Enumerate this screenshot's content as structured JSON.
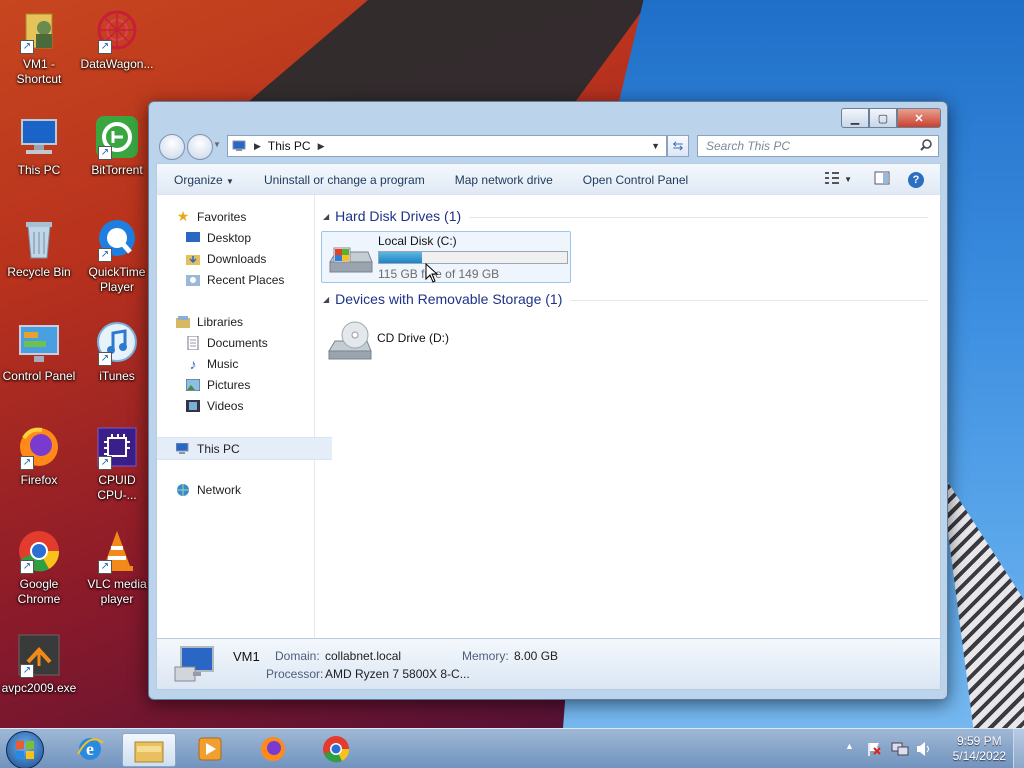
{
  "desktop": {
    "icons": [
      {
        "label": "VM1 - Shortcut",
        "icon": "user-folder-icon"
      },
      {
        "label": "DataWagon...",
        "icon": "datawagon-icon"
      },
      {
        "label": "This PC",
        "icon": "computer-icon"
      },
      {
        "label": "BitTorrent",
        "icon": "bittorrent-icon"
      },
      {
        "label": "Recycle Bin",
        "icon": "recycle-bin-icon"
      },
      {
        "label": "QuickTime Player",
        "icon": "quicktime-icon"
      },
      {
        "label": "Control Panel",
        "icon": "control-panel-icon"
      },
      {
        "label": "iTunes",
        "icon": "itunes-icon"
      },
      {
        "label": "Firefox",
        "icon": "firefox-icon"
      },
      {
        "label": "CPUID CPU-...",
        "icon": "cpuid-icon"
      },
      {
        "label": "Google Chrome",
        "icon": "chrome-icon"
      },
      {
        "label": "VLC media player",
        "icon": "vlc-icon"
      },
      {
        "label": "avpc2009.exe",
        "icon": "avpc-icon"
      }
    ]
  },
  "window": {
    "address": {
      "location": "This PC"
    },
    "search": {
      "placeholder": "Search This PC"
    },
    "toolbar": {
      "organize": "Organize",
      "uninstall": "Uninstall or change a program",
      "map_drive": "Map network drive",
      "control_panel": "Open Control Panel"
    },
    "nav": {
      "favorites": "Favorites",
      "desktop": "Desktop",
      "downloads": "Downloads",
      "recent": "Recent Places",
      "libraries": "Libraries",
      "documents": "Documents",
      "music": "Music",
      "pictures": "Pictures",
      "videos": "Videos",
      "this_pc": "This PC",
      "network": "Network"
    },
    "groups": {
      "hdd": "Hard Disk Drives (1)",
      "removable": "Devices with Removable Storage (1)"
    },
    "drives": {
      "c": {
        "name": "Local Disk (C:)",
        "free": "115 GB free of 149 GB",
        "used_fraction": 0.23
      },
      "d": {
        "name": "CD Drive (D:)"
      }
    },
    "details": {
      "computer_name": "VM1",
      "domain_label": "Domain:",
      "domain": "collabnet.local",
      "memory_label": "Memory:",
      "memory": "8.00 GB",
      "processor_label": "Processor:",
      "processor": "AMD Ryzen 7 5800X 8-C..."
    }
  },
  "taskbar": {
    "time": "9:59 PM",
    "date": "5/14/2022"
  }
}
